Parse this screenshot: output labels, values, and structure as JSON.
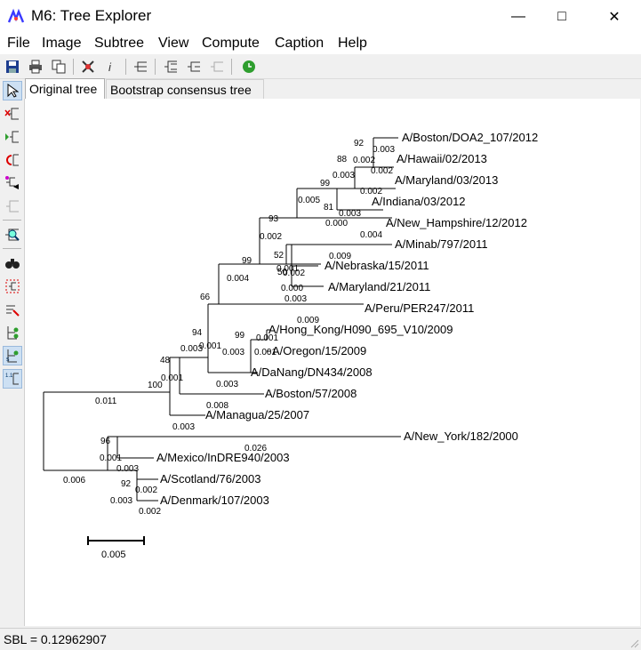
{
  "window": {
    "title": "M6: Tree Explorer"
  },
  "menu": [
    "File",
    "Image",
    "Subtree",
    "View",
    "Compute",
    "Caption",
    "Help"
  ],
  "tabs": {
    "original": "Original tree",
    "bootstrap": "Bootstrap consensus tree"
  },
  "status": {
    "text": "SBL = 0.12962907"
  },
  "tree": {
    "taxa": [
      "A/Boston/DOA2_107/2012",
      "A/Hawaii/02/2013",
      "A/Maryland/03/2013",
      "A/Indiana/03/2012",
      "A/New_Hampshire/12/2012",
      "A/Minab/797/2011",
      "A/Nebraska/15/2011",
      "A/Maryland/21/2011",
      "A/Peru/PER247/2011",
      "A/Hong_Kong/H090_695_V10/2009",
      "A/Oregon/15/2009",
      "A/DaNang/DN434/2008",
      "A/Boston/57/2008",
      "A/Managua/25/2007",
      "A/New_York/182/2000",
      "A/Mexico/InDRE940/2003",
      "A/Scotland/76/2003",
      "A/Denmark/107/2003"
    ],
    "bootstrap": [
      "92",
      "88",
      "99",
      "81",
      "93",
      "52",
      "50",
      "99",
      "66",
      "99",
      "94",
      "48",
      "100",
      "96",
      "92"
    ],
    "branch_lengths": [
      "0.003",
      "0.002",
      "0.002",
      "0.003",
      "0.002",
      "0.005",
      "0.003",
      "0.000",
      "0.004",
      "0.002",
      "0.009",
      "0.002",
      "0.001",
      "0.000",
      "0.003",
      "0.004",
      "0.009",
      "0.001",
      "0.001",
      "0.003",
      "0.001",
      "0.003",
      "0.003",
      "0.001",
      "0.008",
      "0.011",
      "0.003",
      "0.026",
      "0.001",
      "0.003",
      "0.006",
      "0.002",
      "0.003",
      "0.002"
    ],
    "scale_label": "0.005"
  },
  "icons": {
    "app": "tree-explorer-icon",
    "toolbar": [
      "save-icon",
      "print-icon",
      "copy-icon",
      "options-icon",
      "info-icon",
      "subtree-icon",
      "tree-layout-icon",
      "tree-compress-icon",
      "tree-gray-icon",
      "clock-icon"
    ],
    "sidebar": [
      "pointer-icon",
      "place-root-icon",
      "flip-subtree-icon",
      "swap-icon",
      "compress-icon",
      "condense-icon",
      "zoom-icon",
      "find-icon",
      "fit-window-icon",
      "node-marker-icon",
      "topology-icon",
      "branch-length-icon",
      "branch-scale-icon"
    ]
  },
  "colors": {
    "accent_green": "#2e9e2e",
    "selected_bg": "#cde0f3"
  }
}
